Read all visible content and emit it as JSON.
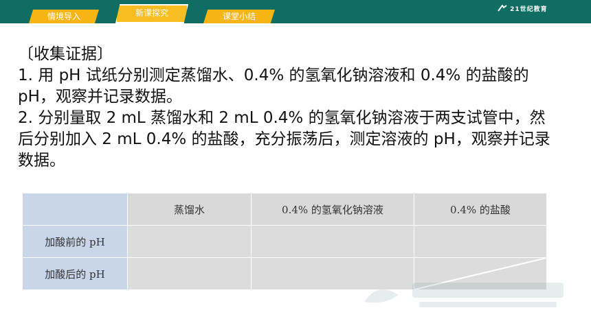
{
  "nav": {
    "tabs": [
      {
        "label": "情境导入",
        "active": false
      },
      {
        "label": "新课探究",
        "active": true
      },
      {
        "label": "课堂小结",
        "active": false
      }
    ],
    "logo_text": "21世纪教育"
  },
  "content": {
    "heading": "〔收集证据〕",
    "paragraph1": "1. 用 pH 试纸分别测定蒸馏水、0.4% 的氢氧化钠溶液和 0.4% 的盐酸的 pH，观察并记录数据。",
    "paragraph2": "2. 分别量取 2 mL 蒸馏水和 2 mL 0.4% 的氢氧化钠溶液于两支试管中，然后分别加入 2 mL 0.4% 的盐酸，充分振荡后，测定溶液的 pH，观察并记录数据。"
  },
  "table": {
    "headers": [
      "",
      "蒸馏水",
      "0.4% 的氢氧化钠溶液",
      "0.4% 的盐酸"
    ],
    "rows": [
      {
        "label": "加酸前的 pH"
      },
      {
        "label": "加酸后的 pH"
      }
    ]
  },
  "colors": {
    "topbar": "#0f6d63",
    "tab": "#f5b514",
    "header_cell": "#d9d9d9",
    "row_label_cell": "#c9d6ea"
  }
}
